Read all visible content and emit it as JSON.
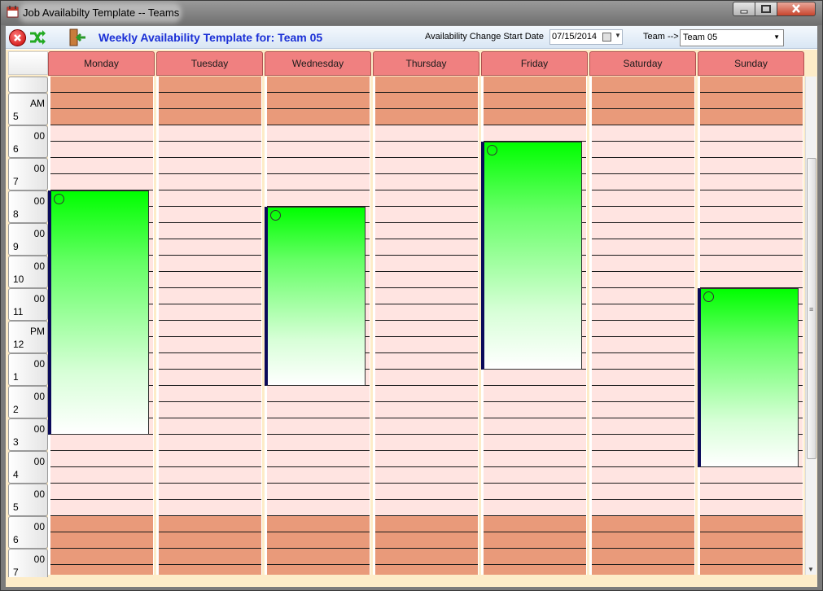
{
  "window": {
    "title": "Job Availabilty Template -- Teams"
  },
  "toolbar": {
    "page_title": "Weekly Availability Template for: Team 05",
    "start_date_label": "Availability Change Start Date",
    "start_date_value": "07/15/2014",
    "team_label": "Team -->",
    "team_value": "Team 05"
  },
  "days": [
    "Monday",
    "Tuesday",
    "Wednesday",
    "Thursday",
    "Friday",
    "Saturday",
    "Sunday"
  ],
  "hours": [
    {
      "hour": "5",
      "min": "AM"
    },
    {
      "hour": "6",
      "min": "00"
    },
    {
      "hour": "7",
      "min": "00"
    },
    {
      "hour": "8",
      "min": "00"
    },
    {
      "hour": "9",
      "min": "00"
    },
    {
      "hour": "10",
      "min": "00"
    },
    {
      "hour": "11",
      "min": "00"
    },
    {
      "hour": "12",
      "min": "PM"
    },
    {
      "hour": "1",
      "min": "00"
    },
    {
      "hour": "2",
      "min": "00"
    },
    {
      "hour": "3",
      "min": "00"
    },
    {
      "hour": "4",
      "min": "00"
    },
    {
      "hour": "5",
      "min": "00"
    },
    {
      "hour": "6",
      "min": "00"
    },
    {
      "hour": "7",
      "min": "00"
    }
  ],
  "availability": [
    {
      "day": "Monday",
      "start": "8:00 AM",
      "end": "3:30 PM"
    },
    {
      "day": "Wednesday",
      "start": "8:30 AM",
      "end": "2:00 PM"
    },
    {
      "day": "Friday",
      "start": "6:30 AM",
      "end": "1:30 PM"
    },
    {
      "day": "Sunday",
      "start": "11:00 AM",
      "end": "4:30 PM"
    }
  ],
  "colors": {
    "header": "#f08080",
    "off_hours_slot": "#e99a7a",
    "work_hours_slot": "#ffe4e1",
    "available_block_top": "#00ff00",
    "title_blue": "#1a2fd6"
  }
}
